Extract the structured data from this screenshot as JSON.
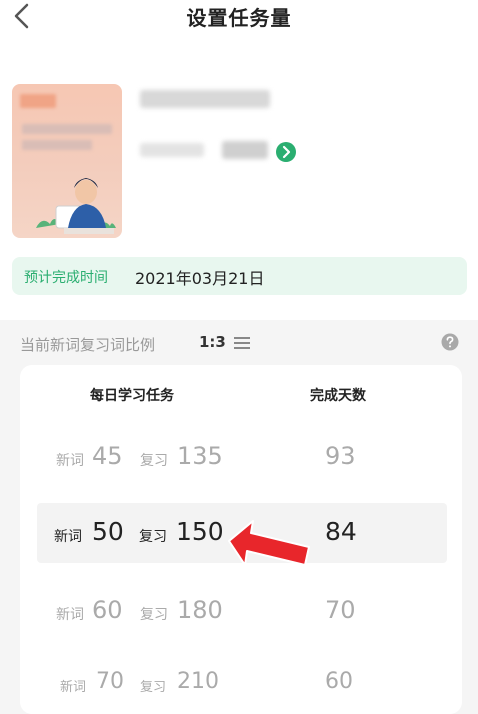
{
  "header": {
    "title": "设置任务量"
  },
  "eta": {
    "label": "预计完成时间",
    "value": "2021年03月21日"
  },
  "ratio": {
    "label": "当前新词复习词比例",
    "value": "1:3"
  },
  "picker": {
    "tasks_header": "每日学习任务",
    "days_header": "完成天数",
    "new_label": "新词",
    "review_label": "复习",
    "rows": [
      {
        "new": "45",
        "review": "135",
        "days": "93",
        "selected": false
      },
      {
        "new": "50",
        "review": "150",
        "days": "84",
        "selected": true
      },
      {
        "new": "60",
        "review": "180",
        "days": "70",
        "selected": false
      },
      {
        "new": "70",
        "review": "210",
        "days": "60",
        "selected": false
      }
    ]
  },
  "colors": {
    "accent": "#2aae70",
    "eta_bg": "#e8f7ef",
    "annotation_arrow": "#e8262b"
  },
  "icons": [
    "back-icon",
    "arrow-circle-icon",
    "menu-icon",
    "help-icon"
  ]
}
